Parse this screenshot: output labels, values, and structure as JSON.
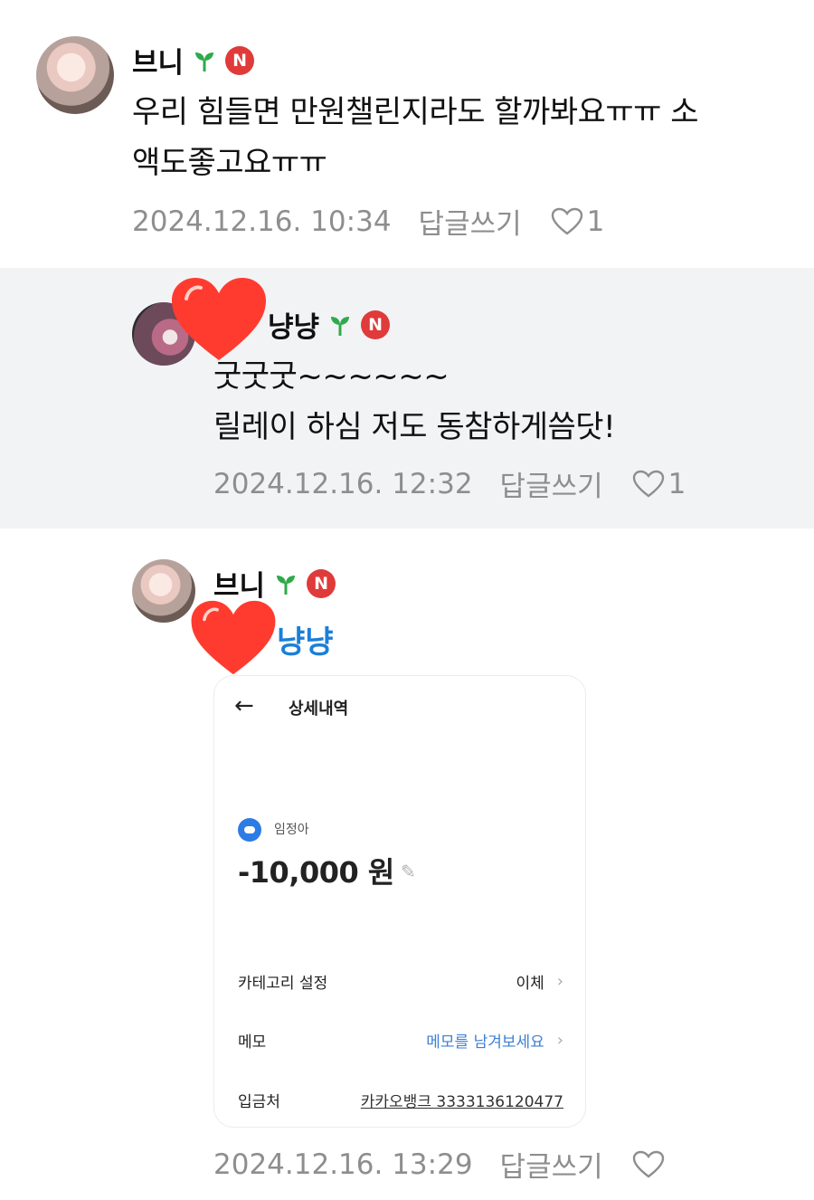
{
  "comments": [
    {
      "author": "브니",
      "text_line1": "우리 힘들면 만원챌린지라도 할까봐요ㅠㅠ 소",
      "text_line2": "액도좋고요ㅠㅠ",
      "date": "2024.12.16. 10:34",
      "reply_label": "답글쓰기",
      "like_count": "1"
    },
    {
      "author": "냥냥",
      "text_line1": "굿굿굿~~~~~~",
      "text_line2": "릴레이 하심 저도 동참하게씀닷!",
      "date": "2024.12.16. 12:32",
      "reply_label": "답글쓰기",
      "like_count": "1"
    },
    {
      "author": "브니",
      "mention": "냥냥",
      "date": "2024.12.16. 13:29",
      "reply_label": "답글쓰기"
    }
  ],
  "badge_letter": "N",
  "receipt": {
    "back_icon": "arrow-left-icon",
    "title": "상세내역",
    "payee": "임정아",
    "amount": "-10,000 원",
    "rows": [
      {
        "label": "카테고리 설정",
        "value": "이체"
      },
      {
        "label": "메모",
        "value": "메모를 남겨보세요"
      },
      {
        "label": "입금처",
        "value": "카카오뱅크 3333136120477"
      }
    ]
  },
  "colors": {
    "reply_bg": "#f2f3f5",
    "badge": "#e03a3a",
    "sprout": "#2eaa4a",
    "mention": "#1b7fd8",
    "sticker_heart": "#ff3b2f"
  }
}
